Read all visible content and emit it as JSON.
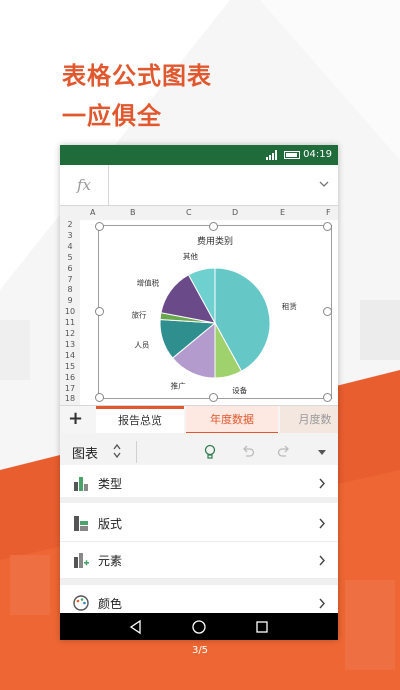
{
  "promo": {
    "line1": "表格公式图表",
    "line2": "一应俱全",
    "page_indicator": "3/5",
    "accent_color": "#e1582e"
  },
  "status": {
    "time": "04:19",
    "bar_color": "#1f6b3a"
  },
  "formula_bar": {
    "fx_label": "fx",
    "value": ""
  },
  "sheet": {
    "columns": [
      "A",
      "B",
      "C",
      "D",
      "E",
      "F"
    ],
    "rows": [
      "2",
      "3",
      "4",
      "5",
      "6",
      "7",
      "8",
      "9",
      "10",
      "11",
      "12",
      "13",
      "14",
      "15",
      "16",
      "17",
      "18"
    ]
  },
  "chart_data": {
    "type": "pie",
    "title": "费用类别",
    "slices": [
      {
        "label": "租赁",
        "value": 42,
        "color": "#65c8c7"
      },
      {
        "label": "设备",
        "value": 8,
        "color": "#9fd26c"
      },
      {
        "label": "推广",
        "value": 14,
        "color": "#b39bcd"
      },
      {
        "label": "人员",
        "value": 12,
        "color": "#2f8f8f"
      },
      {
        "label": "旅行",
        "value": 2,
        "color": "#6aa84f"
      },
      {
        "label": "增值税",
        "value": 14,
        "color": "#6b4a8a"
      },
      {
        "label": "其他",
        "value": 8,
        "color": "#6fd0d0"
      }
    ],
    "legend": "none"
  },
  "tabs": [
    {
      "label": "报告总览"
    },
    {
      "label": "年度数据"
    },
    {
      "label": "月度数"
    }
  ],
  "toolbar": {
    "title": "图表",
    "icons": [
      "swap-icon",
      "lightbulb-icon",
      "undo-icon",
      "redo-icon",
      "dropdown-icon"
    ]
  },
  "menu": [
    {
      "label": "类型",
      "icon": "chart-type-icon"
    },
    {
      "label": "版式",
      "icon": "layout-icon"
    },
    {
      "label": "元素",
      "icon": "elements-icon"
    },
    {
      "label": "颜色",
      "icon": "palette-icon"
    }
  ]
}
